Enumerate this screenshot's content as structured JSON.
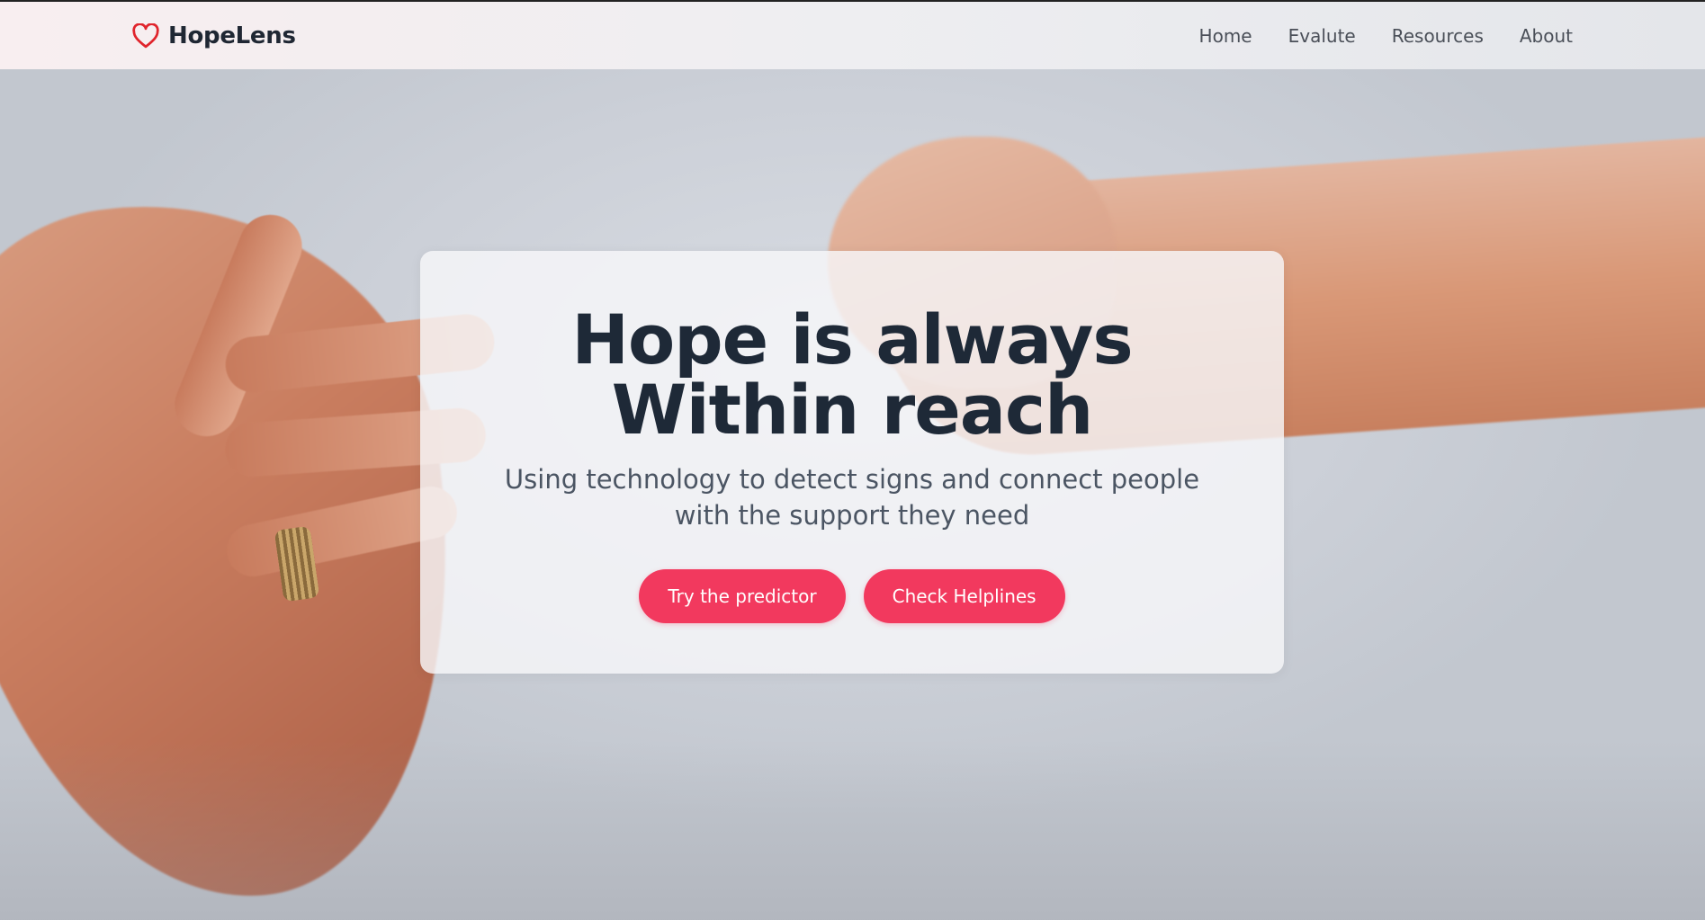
{
  "brand": {
    "name": "HopeLens",
    "icon": "heart-outline-icon",
    "icon_color": "#e0242c"
  },
  "nav": {
    "items": [
      {
        "label": "Home"
      },
      {
        "label": "Evalute"
      },
      {
        "label": "Resources"
      },
      {
        "label": "About"
      }
    ]
  },
  "hero": {
    "title": "Hope is always Within reach",
    "subtitle": "Using technology to detect signs and connect people with the support they need",
    "buttons": {
      "primary_label": "Try the predictor",
      "secondary_label": "Check Helplines"
    }
  },
  "colors": {
    "accent": "#f2395e",
    "heading": "#1e2937",
    "subtext": "#4b5563"
  }
}
